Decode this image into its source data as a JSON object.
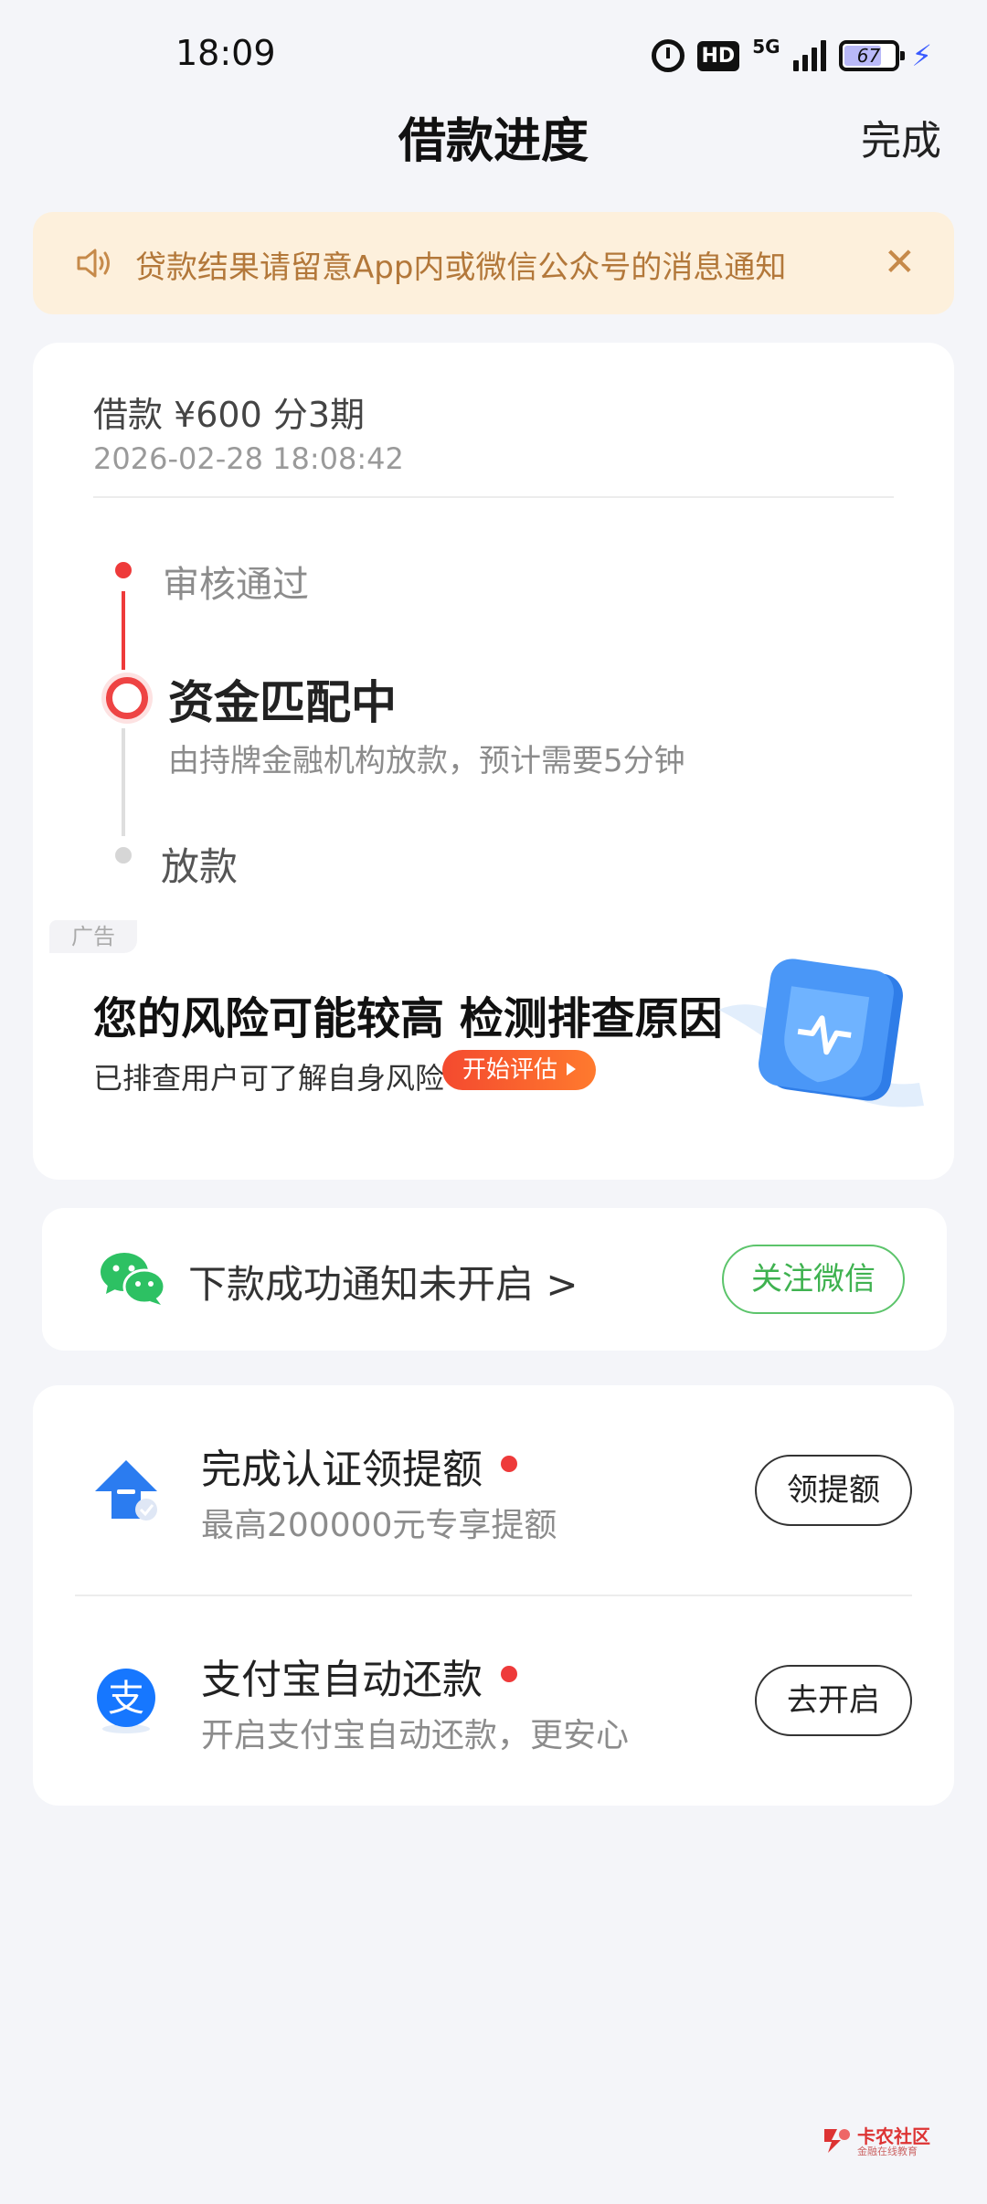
{
  "status_bar": {
    "time": "18:09",
    "hd": "HD",
    "network": "5G",
    "battery": "67",
    "icons": [
      "alarm-icon",
      "signal-icon",
      "battery-icon",
      "charging-icon"
    ]
  },
  "header": {
    "title": "借款进度",
    "done_label": "完成"
  },
  "notice": {
    "text": "贷款结果请留意App内或微信公众号的消息通知",
    "icons": [
      "speaker-icon",
      "close-icon"
    ]
  },
  "loan": {
    "summary": "借款 ¥600   分3期",
    "datetime": "2026-02-28 18:08:42"
  },
  "timeline": {
    "steps": [
      {
        "label": "审核通过",
        "state": "done"
      },
      {
        "label": "资金匹配中",
        "state": "current",
        "desc": "由持牌金融机构放款，预计需要5分钟"
      },
      {
        "label": "放款",
        "state": "pending"
      }
    ]
  },
  "ad": {
    "tag": "广告",
    "title": "您的风险可能较高 检测排查原因",
    "subtitle": "已排查用户可了解自身风险",
    "button": "开始评估"
  },
  "wechat": {
    "text": "下款成功通知未开启 >",
    "button": "关注微信"
  },
  "tasks": [
    {
      "title": "完成认证领提额",
      "desc": "最高200000元专享提额",
      "button": "领提额",
      "icon": "limit-up-icon"
    },
    {
      "title": "支付宝自动还款",
      "desc": "开启支付宝自动还款，更安心",
      "button": "去开启",
      "icon": "alipay-icon"
    }
  ],
  "watermark": {
    "name": "卡农社区",
    "sub": "金融在线教育"
  },
  "colors": {
    "accent_red": "#ee3a3a",
    "notice_bg": "#fdf0dc",
    "notice_text": "#b3783a",
    "wechat_green": "#3fb250",
    "alipay_blue": "#1677ff"
  }
}
